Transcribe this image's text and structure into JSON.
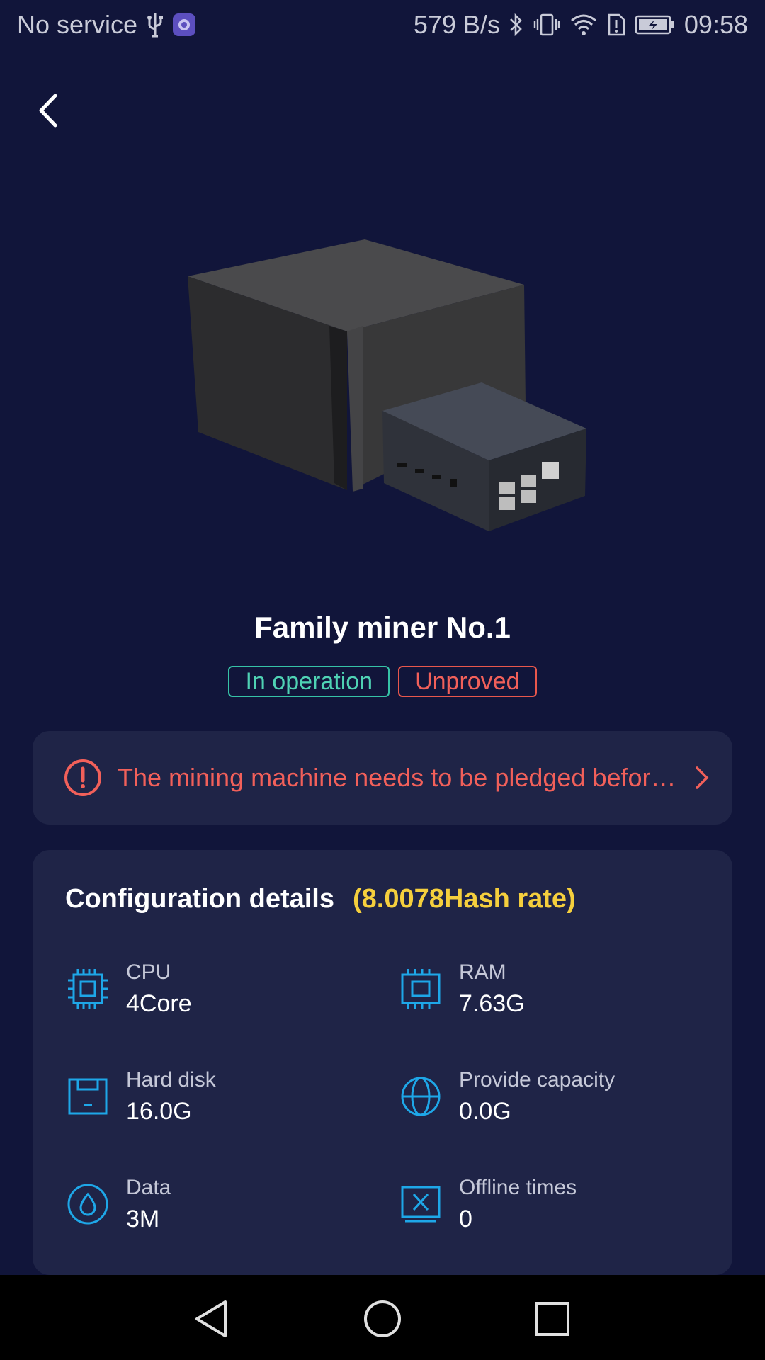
{
  "status_bar": {
    "carrier": "No service",
    "net_speed": "579 B/s",
    "time": "09:58",
    "icons": [
      "usb-icon",
      "app-notification-icon",
      "bluetooth-icon",
      "vibrate-icon",
      "wifi-icon",
      "sim-alert-icon",
      "battery-charging-icon"
    ]
  },
  "device": {
    "name": "Family miner No.1",
    "tags": [
      "In operation",
      "Unproved"
    ]
  },
  "notice": {
    "text": "The mining machine needs to be pledged before …"
  },
  "config": {
    "title": "Configuration details",
    "hash_rate": "(8.0078Hash rate)",
    "specs": [
      {
        "label": "CPU",
        "value": "4Core",
        "icon": "cpu-icon"
      },
      {
        "label": "RAM",
        "value": "7.63G",
        "icon": "ram-icon"
      },
      {
        "label": "Hard disk",
        "value": "16.0G",
        "icon": "hard-disk-icon"
      },
      {
        "label": "Provide capacity",
        "value": "0.0G",
        "icon": "globe-icon"
      },
      {
        "label": "Data",
        "value": "3M",
        "icon": "data-drop-icon"
      },
      {
        "label": "Offline times",
        "value": "0",
        "icon": "offline-icon"
      }
    ]
  },
  "colors": {
    "background": "#11153a",
    "card": "#1f2447",
    "accent_cyan": "#1ea7e8",
    "success": "#36c2a6",
    "danger": "#f2605a",
    "highlight": "#f5cf3d"
  }
}
